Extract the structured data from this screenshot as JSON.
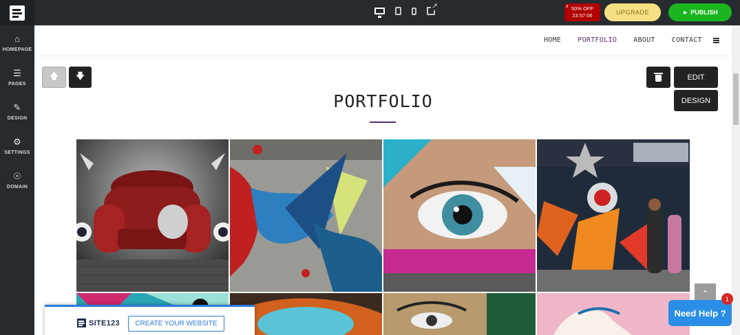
{
  "sidebar": {
    "items": [
      {
        "label": "HOMEPAGE",
        "icon": "home-icon"
      },
      {
        "label": "PAGES",
        "icon": "pages-icon"
      },
      {
        "label": "DESIGN",
        "icon": "brush-icon"
      },
      {
        "label": "SETTINGS",
        "icon": "gear-icon"
      },
      {
        "label": "DOMAIN",
        "icon": "globe-icon"
      }
    ]
  },
  "topbar": {
    "promo_line1": "50% OFF",
    "promo_line2": "23:57:06",
    "promo_close": "x",
    "upgrade_label": "UPGRADE",
    "publish_label": "PUBLISH"
  },
  "site_nav": {
    "links": [
      {
        "label": "HOME",
        "active": false
      },
      {
        "label": "PORTFOLIO",
        "active": true
      },
      {
        "label": "ABOUT",
        "active": false
      },
      {
        "label": "CONTACT",
        "active": false
      }
    ]
  },
  "controls": {
    "edit_label": "EDIT",
    "design_label": "DESIGN"
  },
  "section": {
    "title": "PORTFOLIO"
  },
  "footer_bar": {
    "brand": "SITE123",
    "cta_label": "CREATE YOUR WEBSITE"
  },
  "help": {
    "label": "Need Help ?",
    "badge_count": "1"
  },
  "colors": {
    "editor_bg": "#262b30",
    "accent_purple": "#5b2a6e",
    "publish_green": "#1ab51f",
    "upgrade_yellow": "#f6e083",
    "help_blue": "#2a8ee6"
  }
}
